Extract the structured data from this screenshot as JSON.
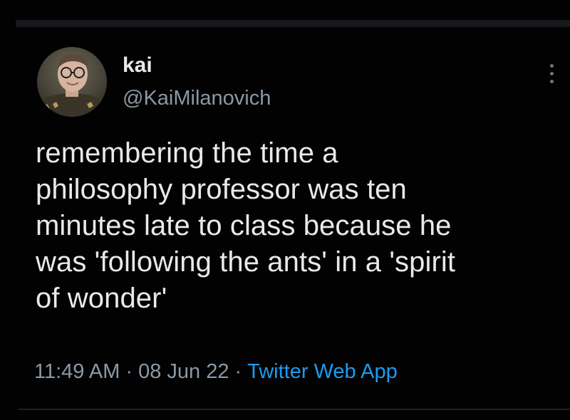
{
  "tweet": {
    "author": {
      "name": "kai",
      "handle": "@KaiMilanovich"
    },
    "text": "remembering the time a\nphilosophy professor was ten\nminutes late to class because he\nwas 'following the ants' in a 'spirit\nof wonder'",
    "time": "11:49 AM",
    "date": "08 Jun 22",
    "separator": "·",
    "source": "Twitter Web App"
  },
  "colors": {
    "background": "#000000",
    "text_primary": "#e7e9ea",
    "text_secondary": "#8b98a5",
    "link": "#1d9bf0"
  },
  "icons": {
    "more": "more-vertical-icon"
  }
}
